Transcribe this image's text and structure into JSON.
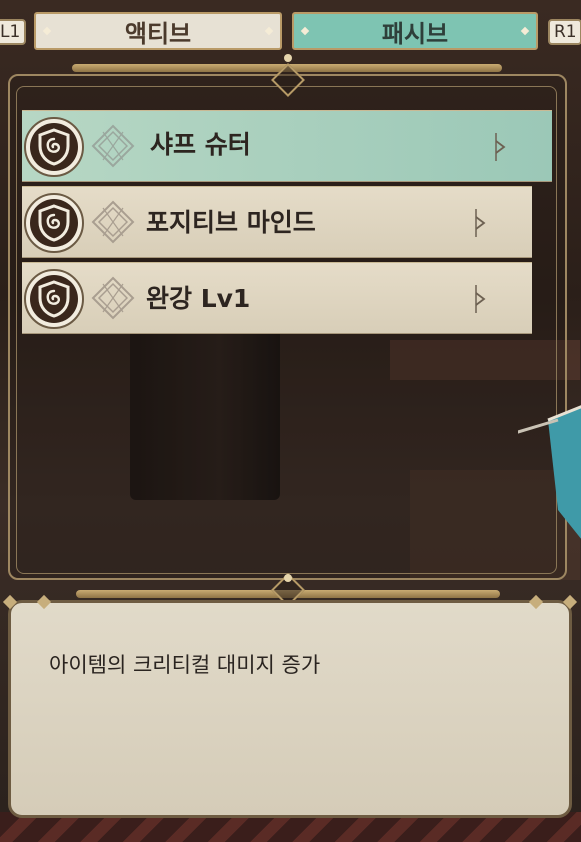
{
  "tabs": [
    {
      "label": "액티브",
      "selected": false
    },
    {
      "label": "패시브",
      "selected": true
    }
  ],
  "keys": {
    "left": "L1",
    "right": "R1"
  },
  "skills": [
    {
      "name": "샤프 슈터",
      "selected": true
    },
    {
      "name": "포지티브 마인드",
      "selected": false
    },
    {
      "name": "완강 Lv1",
      "selected": false
    }
  ],
  "description": "아이템의 크리티컬 대미지 증가",
  "colors": {
    "selected_tab": "#7ec4b2",
    "tab_inactive": "#e7e1d4",
    "selected_row": "#b7d7c4",
    "row": "#e0d7c3",
    "frame_gold": "#b99a67"
  },
  "icons": {
    "skill_icon": "shield-swirl-icon",
    "rune_icon": "rune-diamond-icon",
    "arrow_icon": "chevron-right-icon"
  }
}
